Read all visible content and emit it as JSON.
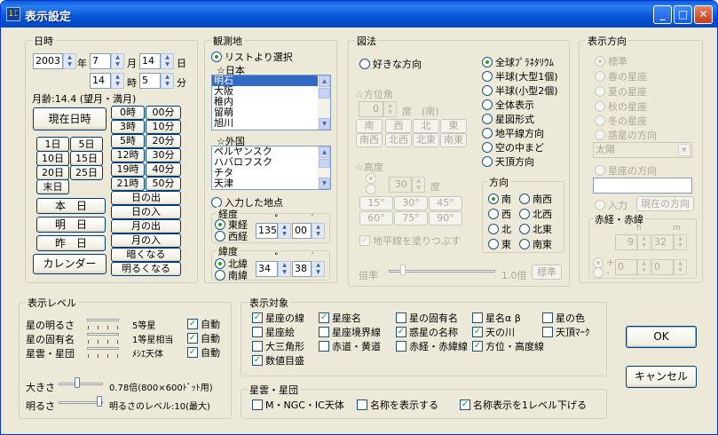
{
  "window": {
    "title": "表示設定",
    "icon_text": "1⌶",
    "minimize": "_",
    "maximize": "□",
    "close": "✕"
  },
  "datetime": {
    "group": "日時",
    "year": "2003",
    "year_unit": "年",
    "month": "7",
    "month_unit": "月",
    "day": "14",
    "day_unit": "日",
    "hour": "14",
    "hour_unit": "時",
    "minute": "5",
    "minute_unit": "分",
    "moon_age": "月齢:14.4 (望月・満月)",
    "now_button": "現在日時",
    "day_buttons": [
      "1日",
      "5日",
      "10日",
      "15日",
      "20日",
      "25日",
      "末日"
    ],
    "rel_buttons": [
      "本　日",
      "明　日",
      "昨　日"
    ],
    "calendar_button": "カレンダー",
    "time_buttons": [
      "0時",
      "00分",
      "3時",
      "10分",
      "5時",
      "20分",
      "12時",
      "30分",
      "19時",
      "40分",
      "21時",
      "50分"
    ],
    "event_buttons": [
      "日の出",
      "日の入",
      "月の出",
      "月の入",
      "暗くなる",
      "明るくなる"
    ]
  },
  "location": {
    "group": "観測地",
    "from_list": "リストより選択",
    "japan_header": "☆日本",
    "japan": [
      "明石",
      "大阪",
      "稚内",
      "留萌",
      "旭川"
    ],
    "foreign_header": "☆外国",
    "foreign": [
      "ペルヤンスク",
      "ハバロフスク",
      "チタ",
      "天津"
    ],
    "manual": "入力した地点",
    "longitude_group": "経度",
    "east": "東経",
    "west": "西経",
    "lon_deg": "135",
    "lon_min": "00",
    "latitude_group": "緯度",
    "north": "北緯",
    "south": "南緯",
    "lat_deg": "34",
    "lat_min": "38",
    "deg_mark": "°",
    "min_mark": "′"
  },
  "view": {
    "group": "図法",
    "free_dir": "好きな方向",
    "azimuth_label": "☆方位角",
    "azimuth_value": "0",
    "azimuth_unit": "度　(南)",
    "az_buttons": [
      "南",
      "西",
      "北",
      "東",
      "南西",
      "北西",
      "北東",
      "南東"
    ],
    "altitude_label": "☆高度",
    "altitude_value": "30",
    "altitude_unit": "度",
    "alt_buttons": [
      "15°",
      "30°",
      "45°",
      "60°",
      "75°",
      "90°"
    ],
    "fill_horizon": "地平線を塗りつぶす",
    "modes": [
      "全球ﾌﾟﾗﾈﾀﾘｳﾑ",
      "半球(大型1個)",
      "半球(小型2個)",
      "全体表示",
      "星図形式",
      "地平線方向",
      "空の中まど",
      "天頂方向"
    ],
    "direction_group": "方向",
    "directions": [
      "南",
      "南西",
      "西",
      "北西",
      "北",
      "北東",
      "東",
      "南東"
    ],
    "zoom_label": "倍率",
    "zoom_value": "1.0倍",
    "standard_button": "標準"
  },
  "display_dir": {
    "group": "表示方向",
    "options": [
      "標準",
      "春の星座",
      "夏の星座",
      "秋の星座",
      "冬の星座",
      "惑星の方向"
    ],
    "planet_select": "太陽",
    "constellation_dir": "星座の方向",
    "input": "入力",
    "current_dir_button": "現在の方向",
    "radec_group": "赤経・赤緯",
    "h": "h",
    "m": "m",
    "ra_h": "9",
    "ra_m": "32",
    "plus": "+",
    "minus": "-",
    "dec_deg": "0",
    "dec_min": "0"
  },
  "level": {
    "group": "表示レベル",
    "rows": [
      {
        "label": "星の明るさ",
        "value": "5等星",
        "auto": "自動"
      },
      {
        "label": "星の固有名",
        "value": "1等星相当",
        "auto": "自動"
      },
      {
        "label": "星雲・星団",
        "value": "ﾒｼｴ天体",
        "auto": "自動"
      }
    ],
    "size_label": "大きさ",
    "size_value": "0.78倍(800×600ﾄﾞｯﾄ用)",
    "bright_label": "明るさ",
    "bright_value": "明るさのレベル:10(最大)"
  },
  "targets": {
    "group": "表示対象",
    "items": [
      {
        "label": "星座の線",
        "checked": true
      },
      {
        "label": "星座名",
        "checked": true
      },
      {
        "label": "星の固有名",
        "checked": false
      },
      {
        "label": "星名α β",
        "checked": false
      },
      {
        "label": "星の色",
        "checked": false
      },
      {
        "label": "星座絵",
        "checked": false
      },
      {
        "label": "星座境界線",
        "checked": false
      },
      {
        "label": "惑星の名称",
        "checked": true
      },
      {
        "label": "天の川",
        "checked": true
      },
      {
        "label": "天頂ﾏｰｸ",
        "checked": false
      },
      {
        "label": "大三角形",
        "checked": false
      },
      {
        "label": "赤道・黄道",
        "checked": false
      },
      {
        "label": "赤経・赤緯線",
        "checked": false
      },
      {
        "label": "方位・高度線",
        "checked": true
      },
      {
        "label": "数値目盛",
        "checked": true
      }
    ]
  },
  "nebula": {
    "group": "星雲・星団",
    "items": [
      {
        "label": "M・NGC・IC天体",
        "checked": false
      },
      {
        "label": "名称を表示する",
        "checked": false
      },
      {
        "label": "名称表示を1レベル下げる",
        "checked": true
      }
    ]
  },
  "dialog": {
    "ok": "OK",
    "cancel": "キャンセル"
  },
  "check_mark": "✓"
}
